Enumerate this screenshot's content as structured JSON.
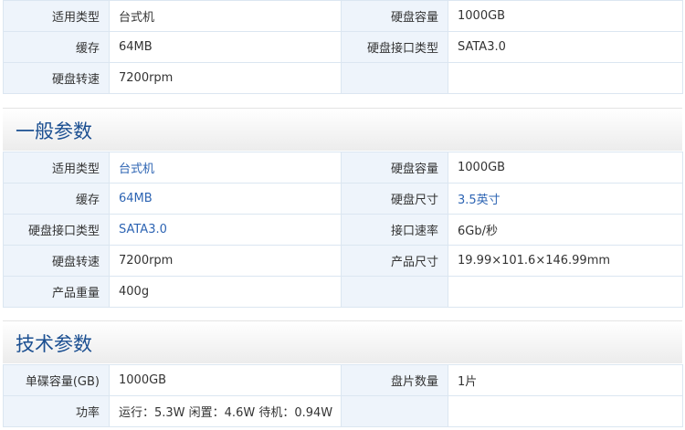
{
  "top_table": {
    "rows": [
      {
        "k1": "适用类型",
        "v1": "台式机",
        "k2": "硬盘容量",
        "v2": "1000GB"
      },
      {
        "k1": "缓存",
        "v1": "64MB",
        "k2": "硬盘接口类型",
        "v2": "SATA3.0"
      },
      {
        "k1": "硬盘转速",
        "v1": "7200rpm",
        "k2": "",
        "v2": ""
      }
    ]
  },
  "general": {
    "title": "一般参数",
    "rows": [
      {
        "k1": "适用类型",
        "v1": "台式机",
        "k2": "硬盘容量",
        "v2": "1000GB"
      },
      {
        "k1": "缓存",
        "v1": "64MB",
        "k2": "硬盘尺寸",
        "v2": "3.5英寸"
      },
      {
        "k1": "硬盘接口类型",
        "v1": "SATA3.0",
        "k2": "接口速率",
        "v2": "6Gb/秒"
      },
      {
        "k1": "硬盘转速",
        "v1": "7200rpm",
        "k2": "产品尺寸",
        "v2": "19.99×101.6×146.99mm"
      },
      {
        "k1": "产品重量",
        "v1": "400g",
        "k2": "",
        "v2": ""
      }
    ]
  },
  "technical": {
    "title": "技术参数",
    "rows": [
      {
        "k1": "单碟容量(GB)",
        "v1": "1000GB",
        "k2": "盘片数量",
        "v2": "1片"
      },
      {
        "k1": "功率",
        "v1": "运行：5.3W 闲置：4.6W 待机：0.94W",
        "k2": "",
        "v2": ""
      }
    ]
  },
  "colors": {
    "label_bg": "#eef4fb",
    "border": "#dbe6f1",
    "title": "#1b4f91",
    "link": "#2d64b3"
  }
}
